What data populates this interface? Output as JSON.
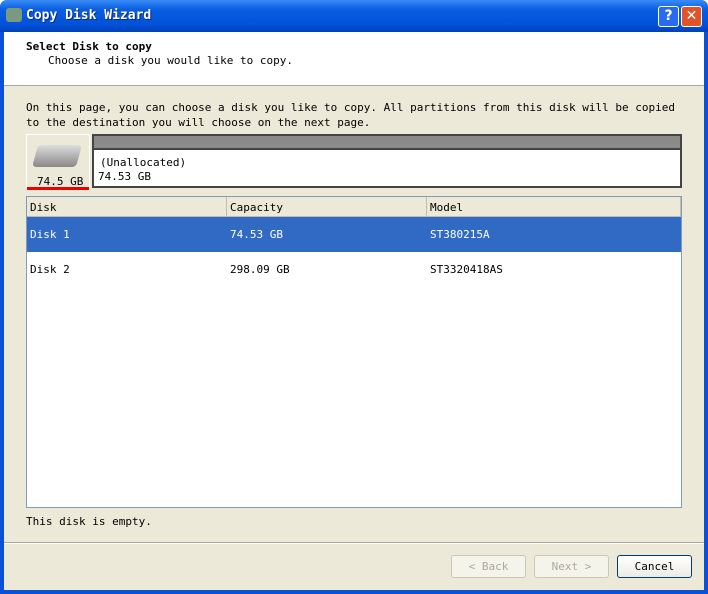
{
  "window": {
    "title": "Copy Disk Wizard",
    "help": "?",
    "close": "✕"
  },
  "header": {
    "title": "Select Disk to copy",
    "subtitle": "Choose a disk you would like to copy."
  },
  "description": "On this page, you can choose a disk you like to copy. All partitions from this disk will be copied to the destination you will choose on the next page.",
  "disk_map": {
    "disk_label": "74.5 GB",
    "partition_name": "(Unallocated)",
    "partition_size": "74.53 GB"
  },
  "table": {
    "columns": [
      "Disk",
      "Capacity",
      "Model"
    ],
    "rows": [
      [
        "Disk 1",
        "74.53 GB",
        "ST380215A"
      ],
      [
        "Disk 2",
        "298.09 GB",
        "ST3320418AS"
      ]
    ],
    "selected": 0
  },
  "status": "This disk is empty.",
  "buttons": {
    "back": "< Back",
    "next": "Next >",
    "cancel": "Cancel"
  }
}
